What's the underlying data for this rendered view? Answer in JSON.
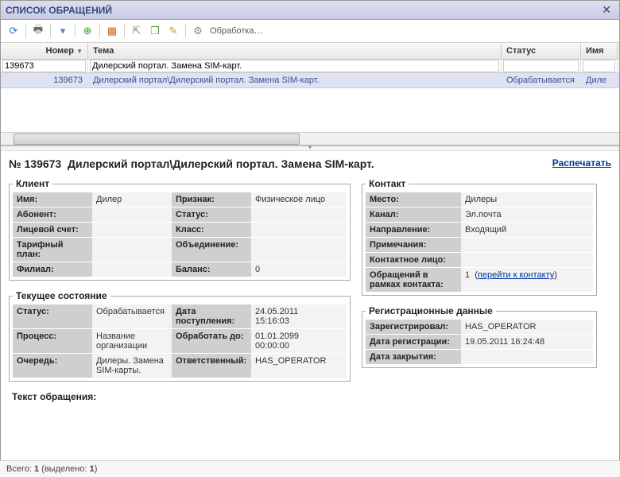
{
  "window": {
    "title": "СПИСОК ОБРАЩЕНИЙ"
  },
  "toolbar": {
    "process_label": "Обработка…"
  },
  "grid": {
    "columns": {
      "number": "Номер",
      "subject": "Тема",
      "status": "Статус",
      "name": "Имя"
    },
    "filter": {
      "number": "139673",
      "subject": "Дилерский портал. Замена SIM-карт."
    },
    "rows": [
      {
        "number": "139673",
        "subject": "Дилерский портал\\Дилерский портал. Замена SIM-карт.",
        "status": "Обрабатывается",
        "name": "Диле"
      }
    ]
  },
  "detail": {
    "prefix": "№ 139673",
    "title": "Дилерский портал\\Дилерский портал. Замена SIM-карт.",
    "print": "Распечатать",
    "client": {
      "legend": "Клиент",
      "name_k": "Имя:",
      "name_v": "Дилер",
      "attr_k": "Признак:",
      "attr_v": "Физическое лицо",
      "subscriber_k": "Абонент:",
      "subscriber_v": "",
      "status_k": "Статус:",
      "status_v": "",
      "account_k": "Лицевой счет:",
      "account_v": "",
      "class_k": "Класс:",
      "class_v": "",
      "plan_k": "Тарифный план:",
      "plan_v": "",
      "union_k": "Объединение:",
      "union_v": "",
      "branch_k": "Филиал:",
      "branch_v": "",
      "balance_k": "Баланс:",
      "balance_v": "0"
    },
    "contact": {
      "legend": "Контакт",
      "place_k": "Место:",
      "place_v": "Дилеры",
      "channel_k": "Канал:",
      "channel_v": "Эл.почта",
      "direction_k": "Направление:",
      "direction_v": "Входящий",
      "notes_k": "Примечания:",
      "notes_v": "",
      "person_k": "Контактное лицо:",
      "person_v": "",
      "reqcount_k": "Обращений в рамках контакта:",
      "reqcount_num": "1",
      "reqcount_link": "перейти к контакту"
    },
    "state": {
      "legend": "Текущее состояние",
      "status_k": "Статус:",
      "status_v": "Обрабатывается",
      "recv_k": "Дата поступления:",
      "recv_v1": "24.05.2011",
      "recv_v2": "15:16:03",
      "process_k": "Процесс:",
      "process_v": "Название организации",
      "due_k": "Обработать до:",
      "due_v1": "01.01.2099",
      "due_v2": "00:00:00",
      "queue_k": "Очередь:",
      "queue_v": "Дилеры. Замена SIM-карты.",
      "resp_k": "Ответственный:",
      "resp_v": "HAS_OPERATOR"
    },
    "reg": {
      "legend": "Регистрационные данные",
      "by_k": "Зарегистрировал:",
      "by_v": "HAS_OPERATOR",
      "date_k": "Дата регистрации:",
      "date_v": "19.05.2011 16:24:48",
      "closed_k": "Дата закрытия:",
      "closed_v": ""
    },
    "body_label": "Текст обращения:"
  },
  "footer": {
    "total_label": "Всего:",
    "total": "1",
    "selected_label": "выделено:",
    "selected": "1"
  }
}
